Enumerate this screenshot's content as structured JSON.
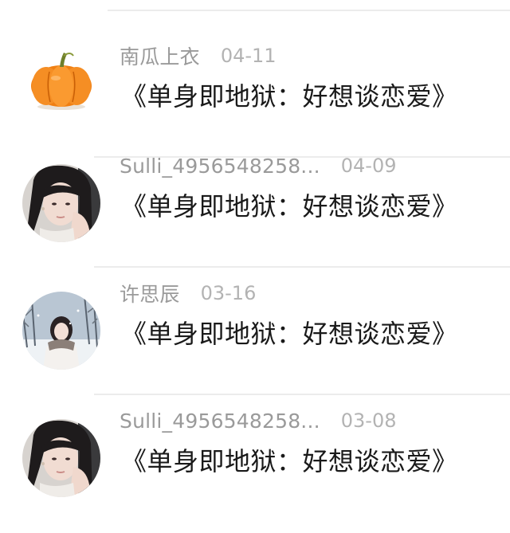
{
  "comments": [
    {
      "username": "南瓜上衣",
      "date": "04-11",
      "text": "《单身即地狱：好想谈恋爱》",
      "avatar_icon": "pumpkin-icon"
    },
    {
      "username": "Sulli_4956548258...",
      "date": "04-09",
      "text": "《单身即地狱：好想谈恋爱》",
      "avatar_icon": "girl-portrait-avatar"
    },
    {
      "username": "许思辰",
      "date": "03-16",
      "text": "《单身即地狱：好想谈恋爱》",
      "avatar_icon": "snow-portrait-avatar"
    },
    {
      "username": "Sulli_4956548258...",
      "date": "03-08",
      "text": "《单身即地狱：好想谈恋爱》",
      "avatar_icon": "girl-portrait-avatar"
    }
  ],
  "colors": {
    "username": "#9a9a9a",
    "date": "#b3b3b3",
    "text": "#1a1a1a",
    "divider": "#ececec",
    "pumpkin": "#f28a1e"
  }
}
